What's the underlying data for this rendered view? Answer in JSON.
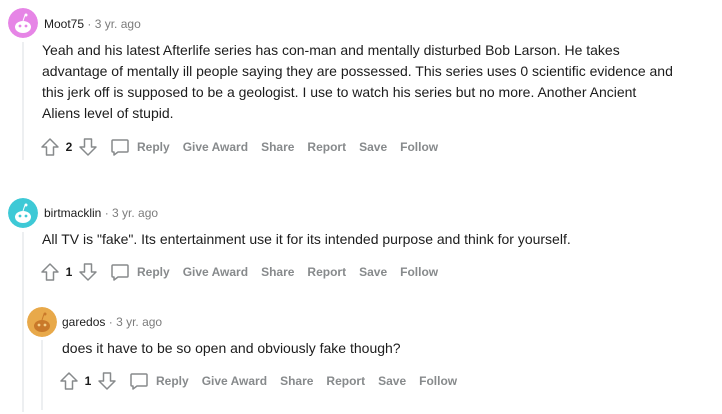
{
  "comments": [
    {
      "username": "Moot75",
      "separator": "·",
      "time": "3 yr. ago",
      "avatar_color": "#e685e6",
      "lines": [
        "Yeah and his latest Afterlife series has con-man and mentally disturbed Bob Larson. He takes",
        "advantage of mentally ill people saying they are possessed. This series uses 0 scientific evidence and",
        "this jerk off is supposed to be a geologist. I use to watch his series but no more. Another Ancient",
        "Aliens level of stupid."
      ],
      "score": "2",
      "actions": {
        "reply": "Reply",
        "give_award": "Give Award",
        "share": "Share",
        "report": "Report",
        "save": "Save",
        "follow": "Follow"
      }
    },
    {
      "username": "birtmacklin",
      "separator": "·",
      "time": "3 yr. ago",
      "avatar_color": "#3ec9d6",
      "lines": [
        "All TV is \"fake\". Its entertainment use it for its intended purpose and think for yourself."
      ],
      "score": "1",
      "actions": {
        "reply": "Reply",
        "give_award": "Give Award",
        "share": "Share",
        "report": "Report",
        "save": "Save",
        "follow": "Follow"
      }
    },
    {
      "username": "garedos",
      "separator": "·",
      "time": "3 yr. ago",
      "avatar_color": "#e8a94a",
      "lines": [
        "does it have to be so open and obviously fake though?"
      ],
      "score": "1",
      "actions": {
        "reply": "Reply",
        "give_award": "Give Award",
        "share": "Share",
        "report": "Report",
        "save": "Save",
        "follow": "Follow"
      }
    }
  ],
  "icons": {
    "upvote": "upvote-arrow-icon",
    "downvote": "downvote-arrow-icon",
    "reply": "speech-bubble-icon",
    "avatar": "snoo-avatar-icon"
  },
  "colors": {
    "text": "#1c1c1c",
    "meta": "#7c7c7c",
    "action": "#878a8c",
    "thread_line": "#edeff1"
  }
}
